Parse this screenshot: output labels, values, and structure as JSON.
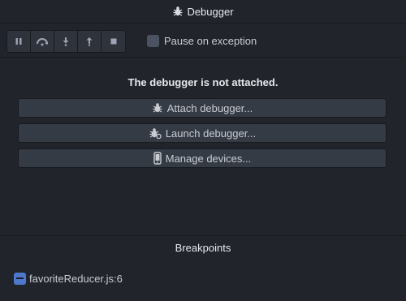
{
  "window": {
    "title": "Debugger"
  },
  "toolbar": {
    "buttons": [
      {
        "name": "pause",
        "icon": "pause-icon"
      },
      {
        "name": "step-over",
        "icon": "step-over-icon"
      },
      {
        "name": "step-into",
        "icon": "step-into-icon"
      },
      {
        "name": "step-out",
        "icon": "step-out-icon"
      },
      {
        "name": "stop",
        "icon": "stop-icon"
      }
    ],
    "pause_on_exception": {
      "label": "Pause on exception",
      "checked": false
    }
  },
  "main": {
    "notice": "The debugger is not attached.",
    "actions": [
      {
        "label": "Attach debugger...",
        "icon": "bug-icon"
      },
      {
        "label": "Launch debugger...",
        "icon": "bug-gear-icon"
      },
      {
        "label": "Manage devices...",
        "icon": "mobile-device-icon"
      }
    ]
  },
  "breakpoints": {
    "title": "Breakpoints",
    "items": [
      {
        "label": "favoriteReducer.js:6",
        "enabled": "partial"
      }
    ]
  },
  "colors": {
    "background": "#21252b",
    "button": "#353b45",
    "accent": "#4d78cc"
  }
}
